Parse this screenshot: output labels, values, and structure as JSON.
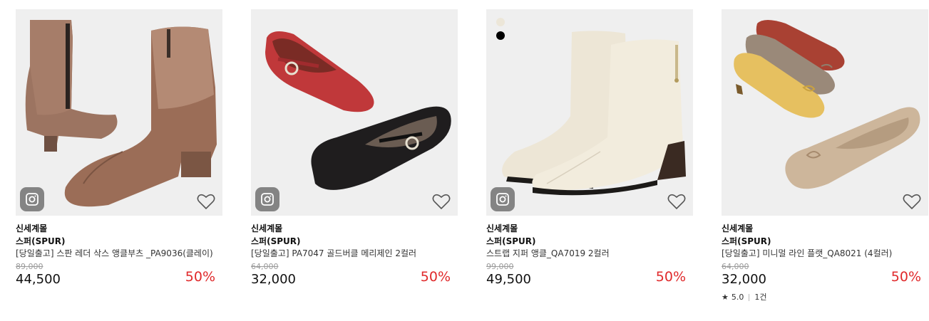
{
  "products": [
    {
      "seller": "신세계몰",
      "brand": "스퍼(SPUR)",
      "name": "[당일출고] 스판 레더 삭스 앵클부츠 _PA9036(클레이)",
      "original_price": "89,000",
      "price": "44,500",
      "discount": "50%",
      "has_instagram": true,
      "image": "brown-sock-ankle-boots"
    },
    {
      "seller": "신세계몰",
      "brand": "스퍼(SPUR)",
      "name": "[당일출고] PA7047 골드버클 메리제인 2컬러",
      "original_price": "64,000",
      "price": "32,000",
      "discount": "50%",
      "has_instagram": true,
      "image": "red-and-black-mary-jane-flats"
    },
    {
      "seller": "신세계몰",
      "brand": "스퍼(SPUR)",
      "name": "스트랩 지퍼 앵클_QA7019 2컬러",
      "original_price": "99,000",
      "price": "49,500",
      "discount": "50%",
      "has_instagram": true,
      "swatches": [
        "#ece6d8",
        "#000000"
      ],
      "image": "ivory-ankle-boots"
    },
    {
      "seller": "신세계몰",
      "brand": "스퍼(SPUR)",
      "name": "[당일출고] 미니멀 라인 플랫_QA8021 (4컬러)",
      "original_price": "64,000",
      "price": "32,000",
      "discount": "50%",
      "has_instagram": false,
      "rating": "5.0",
      "review_count": "1건",
      "image": "ballet-flats-four-colors"
    }
  ],
  "icons": {
    "instagram": "instagram-icon",
    "wishlist": "heart-outline-icon",
    "star": "star-icon"
  },
  "colors": {
    "discount": "#e0292b",
    "image_bg": "#efefef"
  }
}
